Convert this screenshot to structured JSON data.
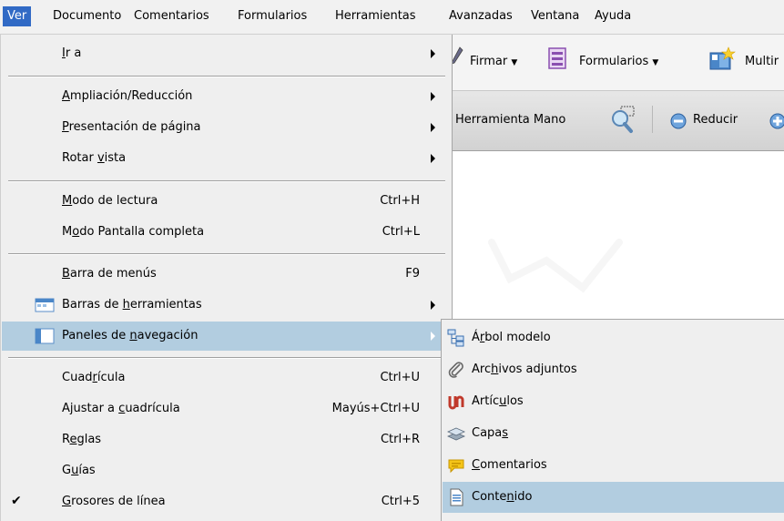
{
  "menubar": {
    "items": [
      "Ver",
      "Documento",
      "Comentarios",
      "Formularios",
      "Herramientas",
      "Avanzadas",
      "Ventana",
      "Ayuda"
    ]
  },
  "toolbar1": {
    "firmar": "Firmar",
    "formularios": "Formularios",
    "multimedia": "Multir"
  },
  "toolbar2": {
    "hand_tool": "Herramienta Mano",
    "reducir": "Reducir"
  },
  "menu": {
    "ir_a": {
      "pre": "",
      "u": "I",
      "post": "r a"
    },
    "ampliacion": {
      "pre": "",
      "u": "A",
      "post": "mpliación/Reducción"
    },
    "presentacion": {
      "pre": "",
      "u": "P",
      "post": "resentación de página"
    },
    "rotar": {
      "pre": "Rotar ",
      "u": "v",
      "post": "ista"
    },
    "lectura": {
      "pre": "",
      "u": "M",
      "post": "odo de lectura",
      "shortcut": "Ctrl+H"
    },
    "pantalla": {
      "pre": "M",
      "u": "o",
      "post": "do Pantalla completa",
      "shortcut": "Ctrl+L"
    },
    "barra_menus": {
      "pre": "",
      "u": "B",
      "post": "arra de menús",
      "shortcut": "F9"
    },
    "barras_herr": {
      "pre": "Barras de ",
      "u": "h",
      "post": "erramientas"
    },
    "paneles": {
      "pre": "Paneles de ",
      "u": "n",
      "post": "avegación"
    },
    "cuadricula": {
      "pre": "Cuad",
      "u": "r",
      "post": "ícula",
      "shortcut": "Ctrl+U"
    },
    "ajustar": {
      "pre": "Ajustar a ",
      "u": "c",
      "post": "uadrícula",
      "shortcut": "Mayús+Ctrl+U"
    },
    "reglas": {
      "pre": "R",
      "u": "e",
      "post": "glas",
      "shortcut": "Ctrl+R"
    },
    "guias": {
      "pre": "G",
      "u": "u",
      "post": "ías"
    },
    "grosores": {
      "pre": "",
      "u": "G",
      "post": "rosores de línea",
      "shortcut": "Ctrl+5",
      "checked": "✔"
    }
  },
  "submenu": {
    "arbol": {
      "pre": "Á",
      "u": "r",
      "post": "bol modelo",
      "icon": "tree-icon"
    },
    "adjuntos": {
      "pre": "Arc",
      "u": "h",
      "post": "ivos adjuntos",
      "icon": "paperclip-icon"
    },
    "articulos": {
      "pre": "Artíc",
      "u": "u",
      "post": "los",
      "icon": "articles-icon"
    },
    "capas": {
      "pre": "Capa",
      "u": "s",
      "post": "",
      "icon": "layers-icon"
    },
    "comentarios": {
      "pre": "",
      "u": "C",
      "post": "omentarios",
      "icon": "speech-bubble-icon"
    },
    "contenido": {
      "pre": "Conte",
      "u": "n",
      "post": "ido",
      "icon": "document-icon"
    }
  },
  "colors": {
    "menubar_active": "#316ac5",
    "highlight": "#b2cde0",
    "menu_bg": "#efefef"
  }
}
